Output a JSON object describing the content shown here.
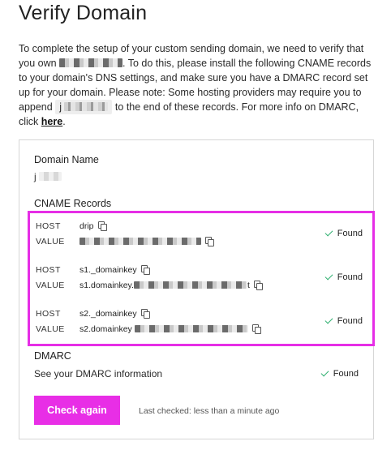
{
  "page": {
    "title": "Verify Domain",
    "intro": {
      "p1": "To complete the setup of your custom sending domain, we need to verify that you own ",
      "p2": ". To do this, please install the following CNAME records to your domain's DNS settings, and make sure you have a DMARC record set up for your domain. Please note: Some hosting providers may require you to append ",
      "chip_prefix": "j",
      "p3": " to the end of these records. For more info on DMARC, click ",
      "link": "here",
      "p4": "."
    }
  },
  "card": {
    "domain_name_label": "Domain Name",
    "domain_name_value": "j",
    "cname_label": "CNAME Records",
    "host_key": "HOST",
    "value_key": "VALUE",
    "records": [
      {
        "host": "drip",
        "value": "",
        "status": "Found"
      },
      {
        "host": "s1._domainkey",
        "value": "s1.domainkey.",
        "value_tail": "t",
        "status": "Found"
      },
      {
        "host": "s2._domainkey",
        "value": "s2.domainkey",
        "status": "Found"
      }
    ],
    "dmarc_label": "DMARC",
    "dmarc_info": "See your DMARC information",
    "dmarc_status": "Found",
    "check_again_label": "Check again",
    "last_checked": "Last checked: less than a minute ago"
  },
  "colors": {
    "accent": "#e82ee6",
    "found_green": "#2fb070"
  },
  "icons": {
    "copy": "copy-icon",
    "check": "checkmark-icon"
  }
}
